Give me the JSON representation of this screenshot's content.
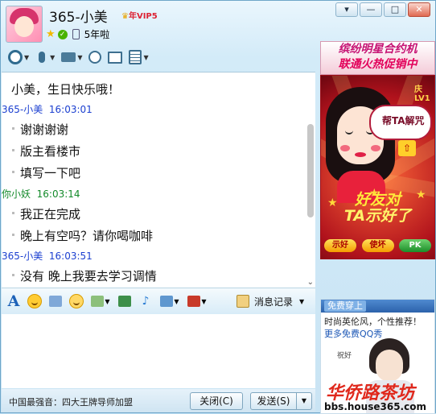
{
  "window": {
    "contact_name": "365-小美",
    "vip_label": "VIP5",
    "vip_prefix": "年",
    "years_label": "5年啦",
    "buttons": {
      "menu": "▾",
      "minimize": "—",
      "maximize": "□",
      "close": "✕"
    }
  },
  "toolbar": {
    "items": [
      {
        "icon": "video-call-icon"
      },
      {
        "icon": "voice-call-icon"
      },
      {
        "icon": "file-transfer-icon"
      },
      {
        "icon": "invite-icon"
      },
      {
        "icon": "remote-assist-icon"
      },
      {
        "icon": "app-icon"
      }
    ]
  },
  "chat": {
    "messages": [
      {
        "type": "text",
        "text": "小美，生日快乐哦！"
      },
      {
        "type": "header",
        "sender": "365-小美",
        "time": "16:03:01",
        "color": "#1b3fd0"
      },
      {
        "type": "text",
        "text": "谢谢谢谢"
      },
      {
        "type": "text",
        "text": "版主看楼市"
      },
      {
        "type": "text",
        "text": "填写一下吧"
      },
      {
        "type": "header",
        "sender": "你小妖",
        "time": "16:03:14",
        "color": "#138a2a"
      },
      {
        "type": "text",
        "text": "我正在完成"
      },
      {
        "type": "text",
        "text": "晚上有空吗？请你喝咖啡"
      },
      {
        "type": "header",
        "sender": "365-小美",
        "time": "16:03:51",
        "color": "#1b3fd0"
      },
      {
        "type": "text",
        "text": "没有 晚上我要去学习调情"
      }
    ]
  },
  "format_bar": {
    "font_label": "A",
    "history_label": "消息记录"
  },
  "bottom": {
    "ticker": "中国最强音：四大王牌导师加盟",
    "close_button": "关闭(C)",
    "send_button": "发送(S)"
  },
  "ads": {
    "top_line1": "缤纷明星合约机",
    "top_line2": "联通火热促销中",
    "main_bubble": "帮TA解咒",
    "main_lv": "庆LV1",
    "main_banner_line1": "好友对",
    "main_banner_line2": "TA示好了",
    "main_buttons": [
      "示好",
      "使坏",
      "PK"
    ],
    "bottom_tag": "免费穿上",
    "bottom_line1": "时尚英伦风，个性推荐！",
    "bottom_line2": "更多免费QQ秀",
    "bottom_note": "祝好",
    "watermark1": "华侨路茶坊",
    "watermark2": "bbs.house365.com"
  }
}
